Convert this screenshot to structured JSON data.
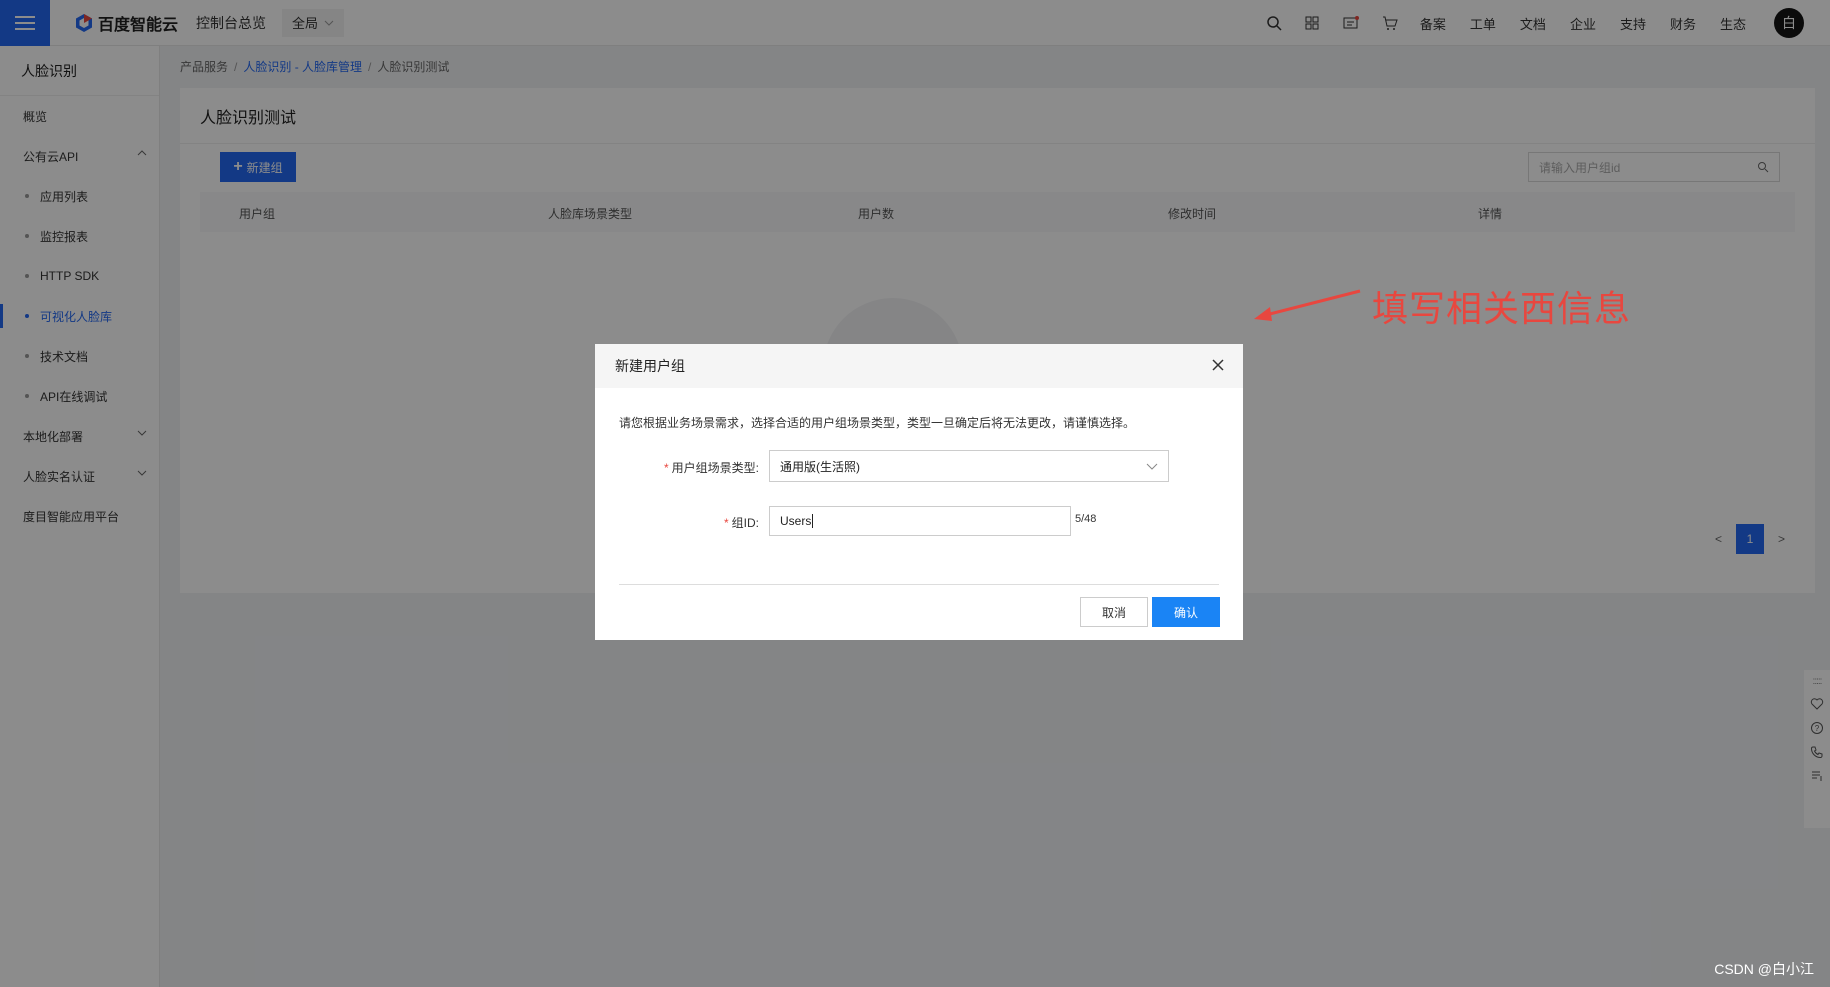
{
  "topbar": {
    "logo_text": "百度智能云",
    "console_link": "控制台总览",
    "region": "全局",
    "links": [
      "备案",
      "工单",
      "文档",
      "企业",
      "支持",
      "财务",
      "生态"
    ],
    "avatar_text": "白"
  },
  "sidebar": {
    "title": "人脸识别",
    "items": {
      "overview": "概览",
      "public_api": "公有云API",
      "app_list": "应用列表",
      "monitor": "监控报表",
      "http_sdk": "HTTP SDK",
      "visual_db": "可视化人脸库",
      "tech_docs": "技术文档",
      "api_debug": "API在线调试",
      "local_deploy": "本地化部署",
      "realname": "人脸实名认证",
      "duomu": "度目智能应用平台"
    }
  },
  "breadcrumb": {
    "root": "产品服务",
    "mid": "人脸识别 - 人脸库管理",
    "current": "人脸识别测试"
  },
  "main": {
    "title": "人脸识别测试",
    "new_group_label": "新建组",
    "search_placeholder": "请输入用户组id",
    "columns": [
      "用户组",
      "人脸库场景类型",
      "用户数",
      "修改时间",
      "详情"
    ],
    "pager": {
      "prev": "<",
      "page": "1",
      "next": ">"
    }
  },
  "annotation": {
    "text": "填写相关西信息",
    "color": "#e8473f"
  },
  "modal": {
    "title": "新建用户组",
    "description": "请您根据业务场景需求，选择合适的用户组场景类型，类型一旦确定后将无法更改，请谨慎选择。",
    "scene_label": "用户组场景类型:",
    "scene_value": "通用版(生活照)",
    "group_id_label": "组ID:",
    "group_id_value": "Users",
    "count": "5/48",
    "cancel_label": "取消",
    "ok_label": "确认",
    "required_mark": "*"
  },
  "watermark": "CSDN @白小江",
  "colors": {
    "primary": "#2468f2",
    "confirm": "#1a84f5"
  }
}
